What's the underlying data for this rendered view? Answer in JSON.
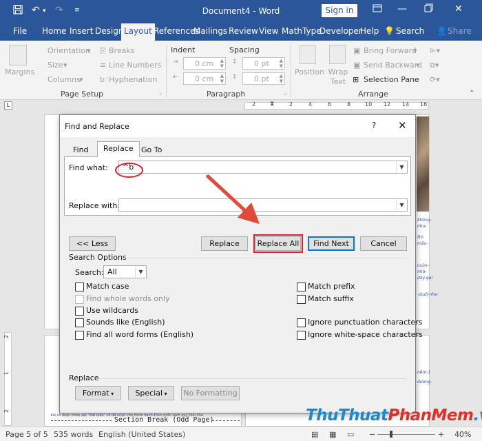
{
  "title_bar": {
    "document_title": "Document4  -  Word",
    "sign_in": "Sign in",
    "icons": [
      "save-icon",
      "undo-icon",
      "redo-icon",
      "customize-qat-icon",
      "ribbon-display-icon",
      "minimize-icon",
      "restore-icon",
      "close-icon"
    ],
    "color": "#2b579a"
  },
  "ribbon_tabs": [
    "File",
    "Home",
    "Insert",
    "Design",
    "Layout",
    "References",
    "Mailings",
    "Review",
    "View",
    "MathType",
    "Developer",
    "Help"
  ],
  "active_tab": "Layout",
  "tell_me": "Search",
  "share": "Share",
  "ribbon": {
    "page_setup": {
      "margins": "Margins",
      "orientation": "Orientation",
      "size": "Size",
      "columns": "Columns",
      "breaks": "Breaks",
      "line_numbers": "Line Numbers",
      "hyphenation": "Hyphenation",
      "group_label": "Page Setup"
    },
    "paragraph": {
      "indent": "Indent",
      "spacing": "Spacing",
      "indent_left": "0 cm",
      "indent_right": "0 cm",
      "spacing_before": "0 pt",
      "spacing_after": "0 pt",
      "group_label": "Paragraph"
    },
    "arrange": {
      "position": "Position",
      "wrap_text": "Wrap Text",
      "bring_forward": "Bring Forward",
      "send_backward": "Send Backward",
      "selection_pane": "Selection Pane",
      "group_label": "Arrange"
    }
  },
  "ruler_numbers": [
    "2",
    "2",
    "4",
    "6",
    "8",
    "10",
    "12",
    "14",
    "16"
  ],
  "vruler_numbers": [
    "2",
    "1",
    "2"
  ],
  "dialog": {
    "title": "Find and Replace",
    "help": "?",
    "tabs": [
      "Find",
      "Replace",
      "Go To"
    ],
    "active_tab": "Replace",
    "find_what_label": "Find what:",
    "find_what_value": "^b",
    "replace_with_label": "Replace with:",
    "replace_with_value": "",
    "buttons": {
      "less": "<< Less",
      "replace": "Replace",
      "replace_all": "Replace All",
      "find_next": "Find Next",
      "cancel": "Cancel"
    },
    "search_options_title": "Search Options",
    "search_label": "Search:",
    "search_value": "All",
    "checkboxes_left": [
      {
        "label": "Match case",
        "checked": false,
        "enabled": true
      },
      {
        "label": "Find whole words only",
        "checked": false,
        "enabled": false
      },
      {
        "label": "Use wildcards",
        "checked": false,
        "enabled": true
      },
      {
        "label": "Sounds like (English)",
        "checked": false,
        "enabled": true
      },
      {
        "label": "Find all word forms (English)",
        "checked": false,
        "enabled": true
      }
    ],
    "checkboxes_right": [
      {
        "label": "Match prefix",
        "checked": false,
        "enabled": true
      },
      {
        "label": "Match suffix",
        "checked": false,
        "enabled": true
      },
      {
        "label": "Ignore punctuation characters",
        "checked": false,
        "enabled": true
      },
      {
        "label": "Ignore white-space characters",
        "checked": false,
        "enabled": true
      }
    ],
    "replace_section_title": "Replace",
    "format_button": "Format",
    "special_button": "Special",
    "no_formatting_button": "No Formatting"
  },
  "document": {
    "section_break": "Section Break (Odd Page)",
    "side_snippets": [
      "khōng-",
      "nhu-",
      "thi-",
      "mâu-",
      "cuōn-",
      "nhà-",
      "dáy-gọi",
      "-dudi-nhe-",
      "nềm-1",
      "dường-"
    ],
    "bottom_snippet": "Đã có được nhan sắc \"bất biến\" cố đã nhận cho thêm hạnh-theo cuốn sách quy thời nhà"
  },
  "status_bar": {
    "page": "Page 5 of 5",
    "words": "535 words",
    "language": "English (United States)",
    "zoom": "40%",
    "zoom_minus": "−",
    "zoom_plus": "+"
  },
  "annotation_color": "#d9202c",
  "watermark": {
    "part1": "ThuThuat",
    "part2": "PhanMem",
    "part3": ".vn"
  }
}
